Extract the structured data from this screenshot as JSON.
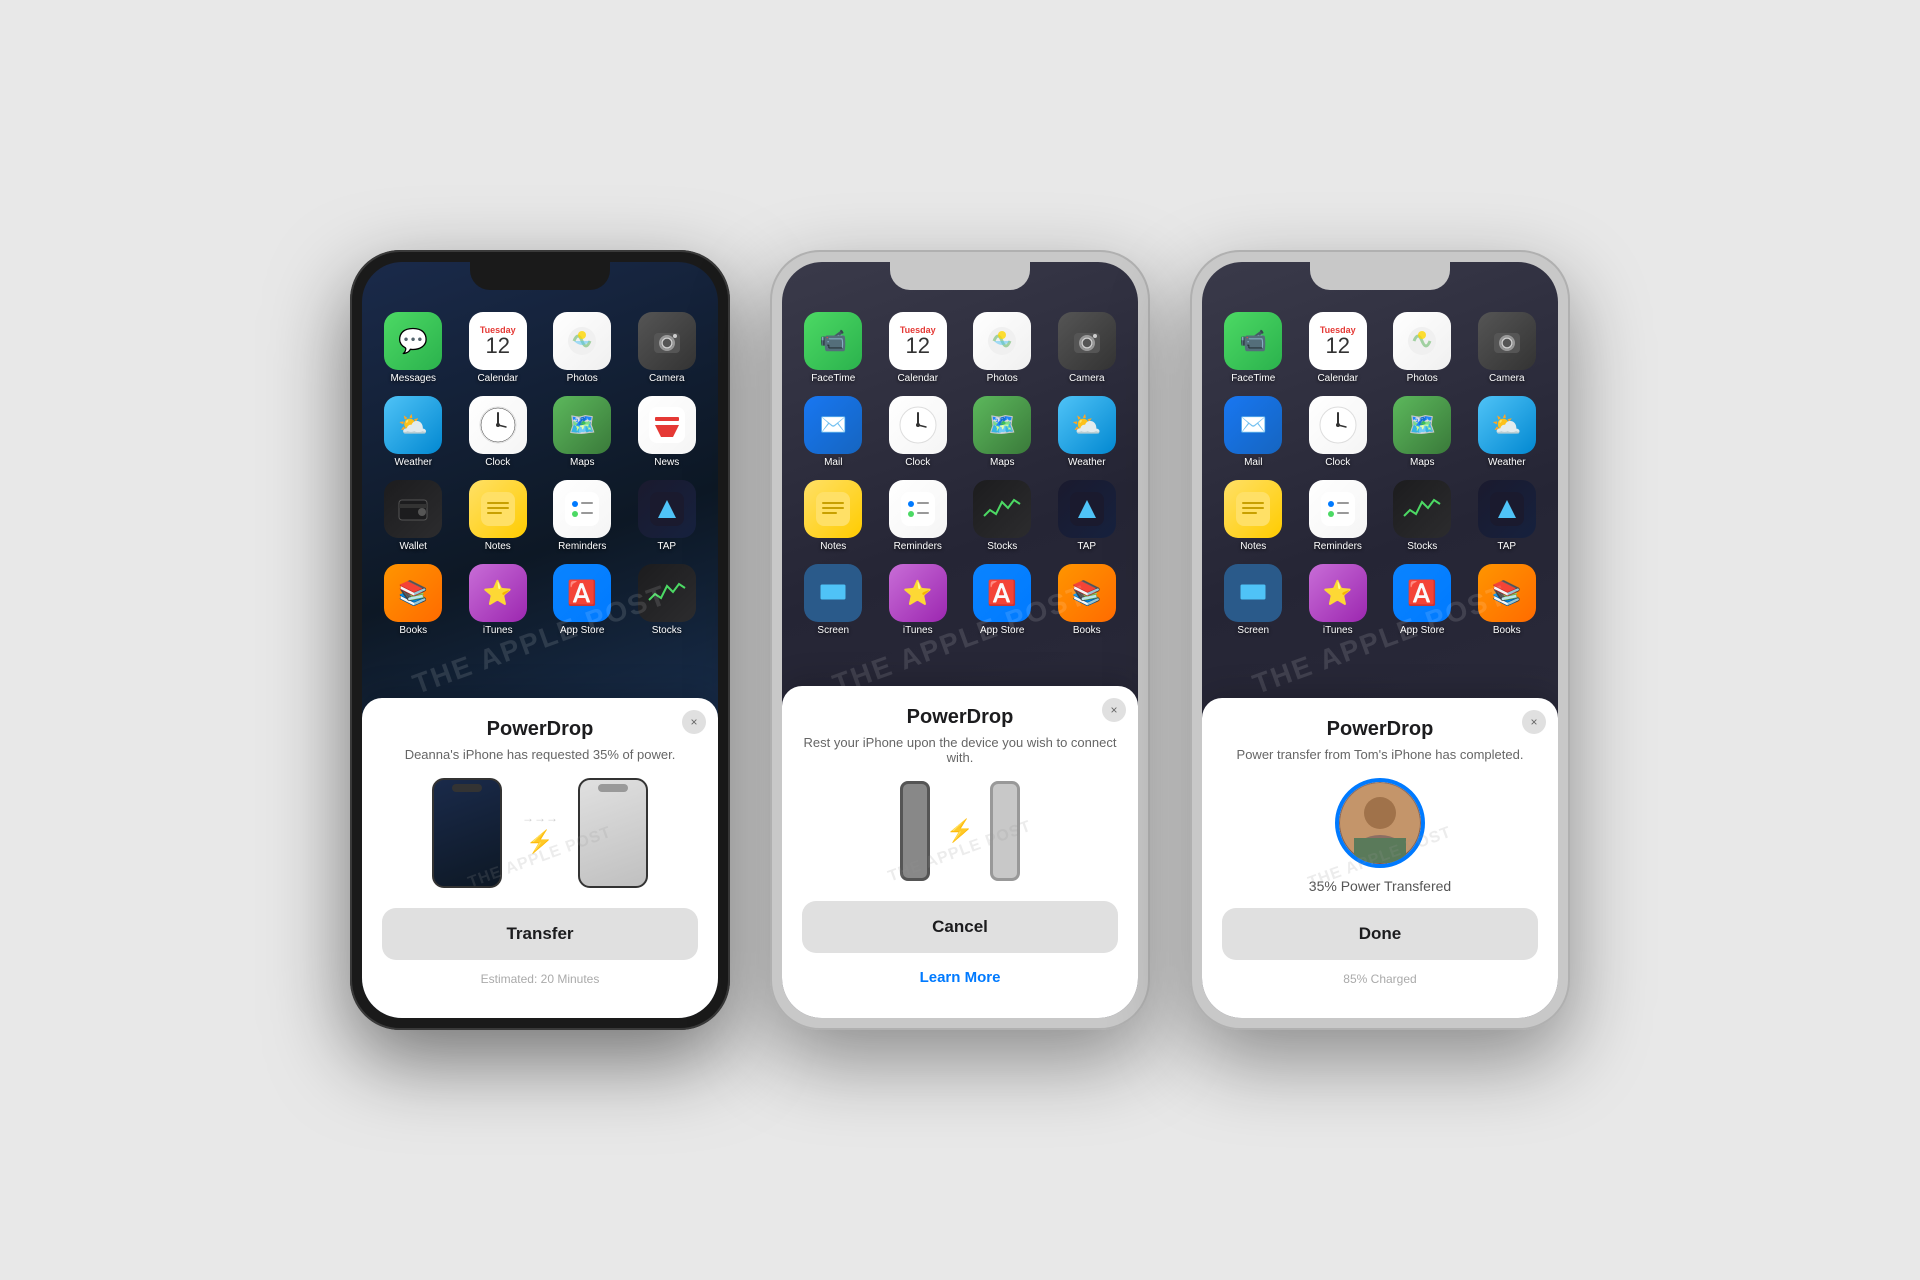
{
  "watermark": "THE APPLE POST",
  "phones": [
    {
      "id": "phone1",
      "style": "dark",
      "apps_row1": [
        {
          "name": "Messages",
          "icon": "messages",
          "label": "Messages"
        },
        {
          "name": "Calendar",
          "icon": "calendar",
          "label": "Calendar",
          "date_day": "Tuesday",
          "date_num": "12"
        },
        {
          "name": "Photos",
          "icon": "photos",
          "label": "Photos"
        },
        {
          "name": "Camera",
          "icon": "camera",
          "label": "Camera"
        }
      ],
      "apps_row2": [
        {
          "name": "Weather",
          "icon": "weather",
          "label": "Weather"
        },
        {
          "name": "Clock",
          "icon": "clock",
          "label": "Clock"
        },
        {
          "name": "Maps",
          "icon": "maps",
          "label": "Maps"
        },
        {
          "name": "News",
          "icon": "news",
          "label": "News"
        }
      ],
      "apps_row3": [
        {
          "name": "Wallet",
          "icon": "wallet",
          "label": "Wallet"
        },
        {
          "name": "Notes",
          "icon": "notes",
          "label": "Notes"
        },
        {
          "name": "Reminders",
          "icon": "reminders",
          "label": "Reminders"
        },
        {
          "name": "TAP",
          "icon": "tap",
          "label": "TAP"
        }
      ],
      "apps_row4": [
        {
          "name": "Books",
          "icon": "books",
          "label": "Books"
        },
        {
          "name": "iTunes",
          "icon": "itunes",
          "label": "iTunes"
        },
        {
          "name": "AppStore",
          "icon": "appstore",
          "label": "App Store"
        },
        {
          "name": "Stocks",
          "icon": "stocks",
          "label": "Stocks"
        }
      ],
      "modal": {
        "title": "PowerDrop",
        "subtitle": "Deanna's iPhone has requested 35% of power.",
        "close_label": "×",
        "transfer_btn": "Transfer",
        "footer": "Estimated: 20 Minutes"
      }
    },
    {
      "id": "phone2",
      "style": "silver",
      "apps_row1": [
        {
          "name": "FaceTime",
          "icon": "facetime",
          "label": "FaceTime"
        },
        {
          "name": "Calendar",
          "icon": "calendar",
          "label": "Calendar",
          "date_day": "Tuesday",
          "date_num": "12"
        },
        {
          "name": "Photos",
          "icon": "photos",
          "label": "Photos"
        },
        {
          "name": "Camera",
          "icon": "camera",
          "label": "Camera"
        }
      ],
      "apps_row2": [
        {
          "name": "Mail",
          "icon": "mail",
          "label": "Mail"
        },
        {
          "name": "Clock",
          "icon": "clock",
          "label": "Clock"
        },
        {
          "name": "Maps",
          "icon": "maps",
          "label": "Maps"
        },
        {
          "name": "Weather",
          "icon": "weather",
          "label": "Weather"
        }
      ],
      "apps_row3": [
        {
          "name": "Notes",
          "icon": "notes",
          "label": "Notes"
        },
        {
          "name": "Reminders",
          "icon": "reminders",
          "label": "Reminders"
        },
        {
          "name": "Stocks",
          "icon": "stocks",
          "label": "Stocks"
        },
        {
          "name": "TAP",
          "icon": "tap",
          "label": "TAP"
        }
      ],
      "apps_row4": [
        {
          "name": "Screen",
          "icon": "screen",
          "label": "Screen"
        },
        {
          "name": "iTunes",
          "icon": "itunes",
          "label": "iTunes"
        },
        {
          "name": "AppStore",
          "icon": "appstore",
          "label": "App Store"
        },
        {
          "name": "Books",
          "icon": "books",
          "label": "Books"
        }
      ],
      "modal": {
        "title": "PowerDrop",
        "subtitle": "Rest your iPhone upon the device you wish to connect with.",
        "close_label": "×",
        "cancel_btn": "Cancel",
        "learn_more": "Learn More"
      }
    },
    {
      "id": "phone3",
      "style": "silver",
      "apps_row1": [
        {
          "name": "FaceTime",
          "icon": "facetime",
          "label": "FaceTime"
        },
        {
          "name": "Calendar",
          "icon": "calendar",
          "label": "Calendar",
          "date_day": "Tuesday",
          "date_num": "12"
        },
        {
          "name": "Photos",
          "icon": "photos",
          "label": "Photos"
        },
        {
          "name": "Camera",
          "icon": "camera",
          "label": "Camera"
        }
      ],
      "apps_row2": [
        {
          "name": "Mail",
          "icon": "mail",
          "label": "Mail"
        },
        {
          "name": "Clock",
          "icon": "clock",
          "label": "Clock"
        },
        {
          "name": "Maps",
          "icon": "maps",
          "label": "Maps"
        },
        {
          "name": "Weather",
          "icon": "weather",
          "label": "Weather"
        }
      ],
      "apps_row3": [
        {
          "name": "Notes",
          "icon": "notes",
          "label": "Notes"
        },
        {
          "name": "Reminders",
          "icon": "reminders",
          "label": "Reminders"
        },
        {
          "name": "Stocks",
          "icon": "stocks",
          "label": "Stocks"
        },
        {
          "name": "TAP",
          "icon": "tap",
          "label": "TAP"
        }
      ],
      "apps_row4": [
        {
          "name": "Screen",
          "icon": "screen",
          "label": "Screen"
        },
        {
          "name": "iTunes",
          "icon": "itunes",
          "label": "iTunes"
        },
        {
          "name": "AppStore",
          "icon": "appstore",
          "label": "App Store"
        },
        {
          "name": "Books",
          "icon": "books",
          "label": "Books"
        }
      ],
      "modal": {
        "title": "PowerDrop",
        "subtitle": "Power transfer from Tom's iPhone has completed.",
        "close_label": "×",
        "power_pct": "35% Power Transfered",
        "done_btn": "Done",
        "footer": "85% Charged"
      }
    }
  ]
}
